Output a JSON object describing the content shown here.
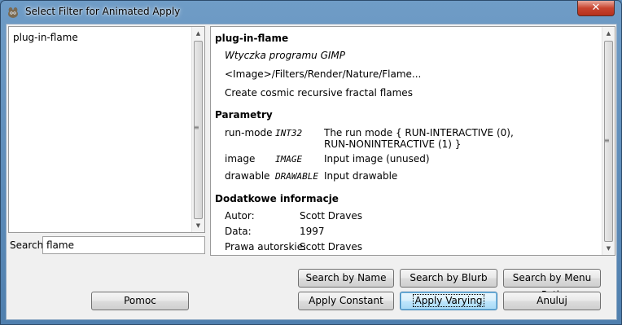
{
  "window": {
    "title": "Select Filter for Animated Apply",
    "close_label": "✕"
  },
  "list": {
    "items": [
      "plug-in-flame"
    ]
  },
  "search": {
    "label": "Search:",
    "value": "flame"
  },
  "info": {
    "name": "plug-in-flame",
    "blurb": "Wtyczka programu GIMP",
    "menu_path": "<Image>/Filters/Render/Nature/Flame...",
    "description": "Create cosmic recursive fractal flames",
    "params_heading": "Parametry",
    "params": [
      {
        "name": "run-mode",
        "type": "INT32",
        "desc": "The run mode { RUN-INTERACTIVE (0), RUN-NONINTERACTIVE (1) }"
      },
      {
        "name": "image",
        "type": "IMAGE",
        "desc": "Input image (unused)"
      },
      {
        "name": "drawable",
        "type": "DRAWABLE",
        "desc": "Input drawable"
      }
    ],
    "extra_heading": "Dodatkowe informacje",
    "extra": [
      {
        "label": "Autor:",
        "value": "Scott Draves"
      },
      {
        "label": "Data:",
        "value": "1997"
      },
      {
        "label": "Prawa autorskie:",
        "value": "Scott Draves"
      }
    ]
  },
  "buttons": {
    "search_by_name": "Search by Name",
    "search_by_blurb": "Search by Blurb",
    "search_by_menu_path": "Search by Menu Path",
    "help": "Pomoc",
    "apply_constant": "Apply Constant",
    "apply_varying": "Apply Varying",
    "cancel": "Anuluj"
  }
}
